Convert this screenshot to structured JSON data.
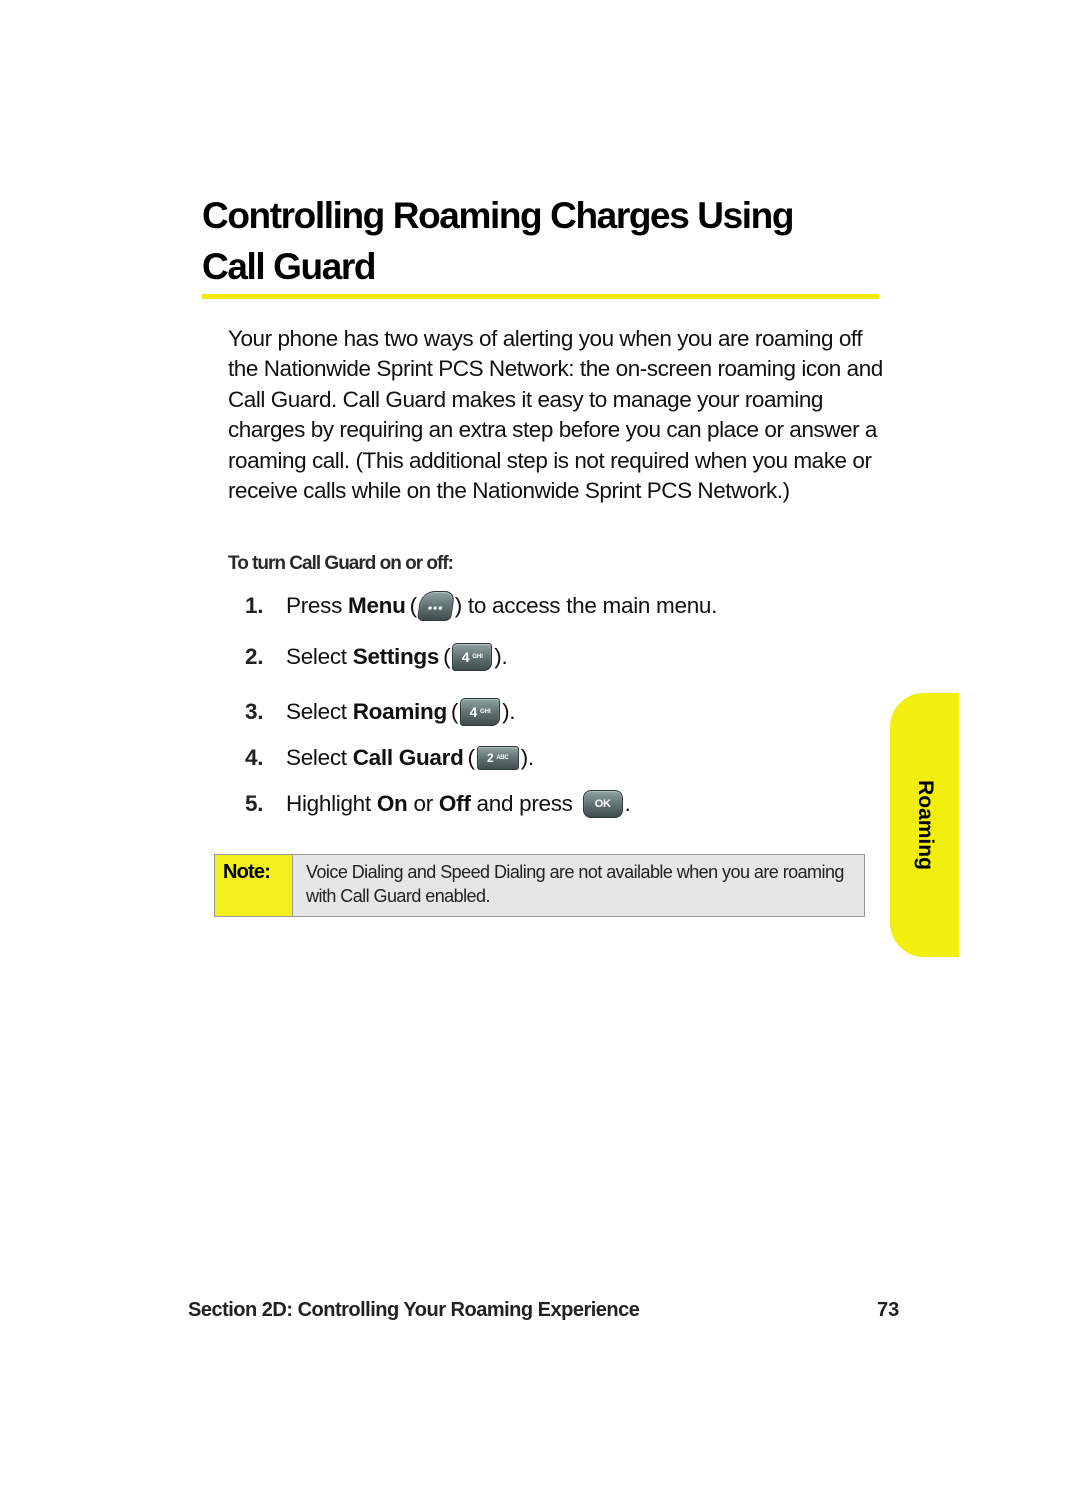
{
  "page": {
    "title_line1": "Controlling Roaming Charges Using",
    "title_line2": "Call Guard",
    "intro": "Your phone has two ways of alerting you when you are roaming off the Nationwide Sprint PCS Network: the on-screen roaming icon and Call Guard. Call Guard makes it easy to manage your roaming charges by requiring an extra step before you can place or answer a roaming call. (This additional step is not required when you make or receive calls while on the Nationwide Sprint PCS Network.)",
    "procedure_heading": "To turn Call Guard on or off:"
  },
  "steps": [
    {
      "num": "1.",
      "pre": "Press",
      "bold": "Menu",
      "open": "(",
      "key": "•••",
      "close": ") to access the main menu."
    },
    {
      "num": "2.",
      "pre": "Select",
      "bold": "Settings",
      "open": "(",
      "key_main": "4",
      "key_sub": "GHI",
      "close": ")."
    },
    {
      "num": "3.",
      "pre": "Select",
      "bold": "Roaming",
      "open": "(",
      "key_main": "4",
      "key_sub": "GHI",
      "close": ")."
    },
    {
      "num": "4.",
      "pre": "Select",
      "bold": "Call Guard",
      "open": "(",
      "key_main": "2",
      "key_sub": "ABC",
      "close": ")."
    },
    {
      "num": "5.",
      "pre": "Highlight",
      "bold_on": "On",
      "mid": "or",
      "bold_off": "Off",
      "post": "and press",
      "key": "OK",
      "close": "."
    }
  ],
  "note": {
    "label": "Note:",
    "text": "Voice Dialing and Speed Dialing are not available when you are roaming with Call Guard enabled."
  },
  "side_tab": {
    "label": "Roaming"
  },
  "footer": {
    "section": "Section 2D: Controlling Your Roaming Experience",
    "page_number": "73"
  },
  "colors": {
    "accent_yellow": "#f2ef0f",
    "note_bg": "#e6e6e6"
  }
}
